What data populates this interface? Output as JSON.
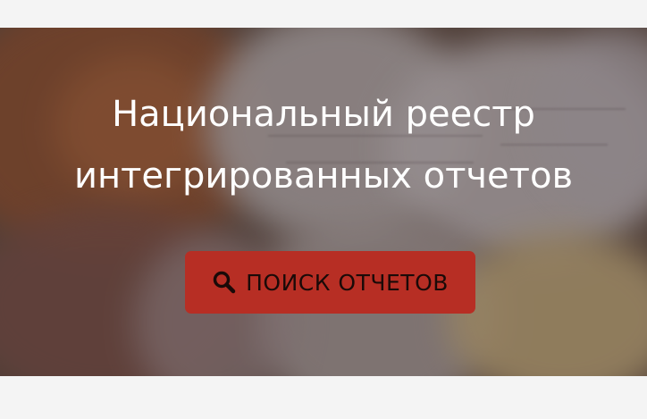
{
  "hero": {
    "title_line1": "Национальный реестр",
    "title_line2": "интегрированных отчетов",
    "search_button_label": "ПОИСК ОТЧЕТОВ",
    "search_icon": "search-icon"
  },
  "colors": {
    "button_bg": "#b72e24",
    "title_text": "#ffffff",
    "page_bg": "#f4f4f4"
  }
}
